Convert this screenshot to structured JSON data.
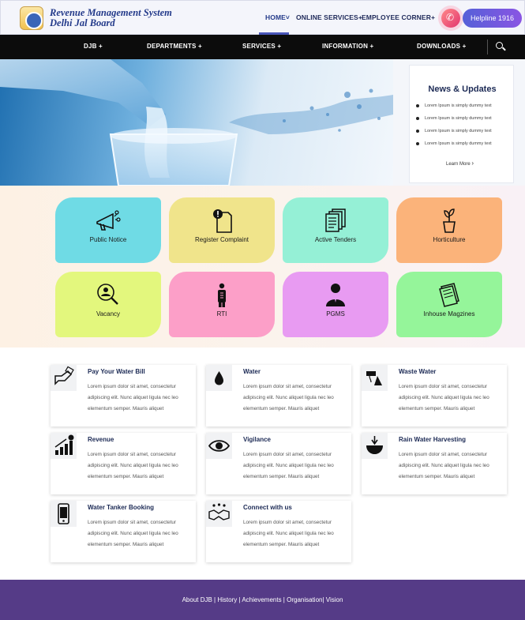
{
  "header": {
    "brand_line1": "Revenue Management System",
    "brand_line2": "Delhi Jal Board",
    "nav": {
      "home": "HOME",
      "online": "ONLINE SERVICES",
      "employee": "EMPLOYEE CORNER"
    },
    "helpline": "Helpline 1916"
  },
  "mainnav": {
    "items": [
      "DJB",
      "DEPARTMENTS",
      "SERVICES",
      "INFORMATION",
      "DOWNLOADS"
    ]
  },
  "news": {
    "title": "News & Updates",
    "items": [
      "Lorem Ipsum is simply dummy text",
      "Lorem Ipsum is simply dummy text",
      "Lorem Ipsum is simply dummy text",
      "Lorem Ipsum is simply dummy text"
    ],
    "learn_more": "Learn More"
  },
  "quicklinks": [
    {
      "label": "Public Notice",
      "color": "#6fdbe5"
    },
    {
      "label": "Register Complaint",
      "color": "#f0e48b"
    },
    {
      "label": "Active Tenders",
      "color": "#95f0d6"
    },
    {
      "label": "Horticulture",
      "color": "#fbb37a"
    },
    {
      "label": "Vacancy",
      "color": "#e3f77d"
    },
    {
      "label": "RTI",
      "color": "#fc9fc8"
    },
    {
      "label": "PGMS",
      "color": "#e89bf2"
    },
    {
      "label": "Inhouse Magzines",
      "color": "#95f59a"
    }
  ],
  "services": [
    {
      "title": "Pay Your Water Bill",
      "desc": "Lorem ipsum dolor sit amet, consectetur adipiscing elit. Nunc aliquet ligula nec leo elementum semper. Mauris aliquet"
    },
    {
      "title": "Water",
      "desc": "Lorem ipsum dolor sit amet, consectetur adipiscing elit. Nunc aliquet ligula nec leo elementum semper. Mauris aliquet"
    },
    {
      "title": "Waste Water",
      "desc": "Lorem ipsum dolor sit amet, consectetur adipiscing elit. Nunc aliquet ligula nec leo elementum semper. Mauris aliquet"
    },
    {
      "title": "Revenue",
      "desc": "Lorem ipsum dolor sit amet, consectetur adipiscing elit. Nunc aliquet ligula nec leo elementum semper. Mauris aliquet"
    },
    {
      "title": "Vigilance",
      "desc": "Lorem ipsum dolor sit amet, consectetur adipiscing elit. Nunc aliquet ligula nec leo elementum semper. Mauris aliquet"
    },
    {
      "title": "Rain Water Harvesting",
      "desc": "Lorem ipsum dolor sit amet, consectetur adipiscing elit. Nunc aliquet ligula nec leo elementum semper. Mauris aliquet"
    },
    {
      "title": "Water Tanker Booking",
      "desc": "Lorem ipsum dolor sit amet, consectetur adipiscing elit. Nunc aliquet ligula nec leo elementum semper. Mauris aliquet"
    },
    {
      "title": "Connect with us",
      "desc": "Lorem ipsum dolor sit amet, consectetur adipiscing elit. Nunc aliquet ligula nec leo elementum semper. Mauris aliquet"
    }
  ],
  "footer": {
    "links": "About DJB | History | Achievements | Organisation| Vision"
  }
}
